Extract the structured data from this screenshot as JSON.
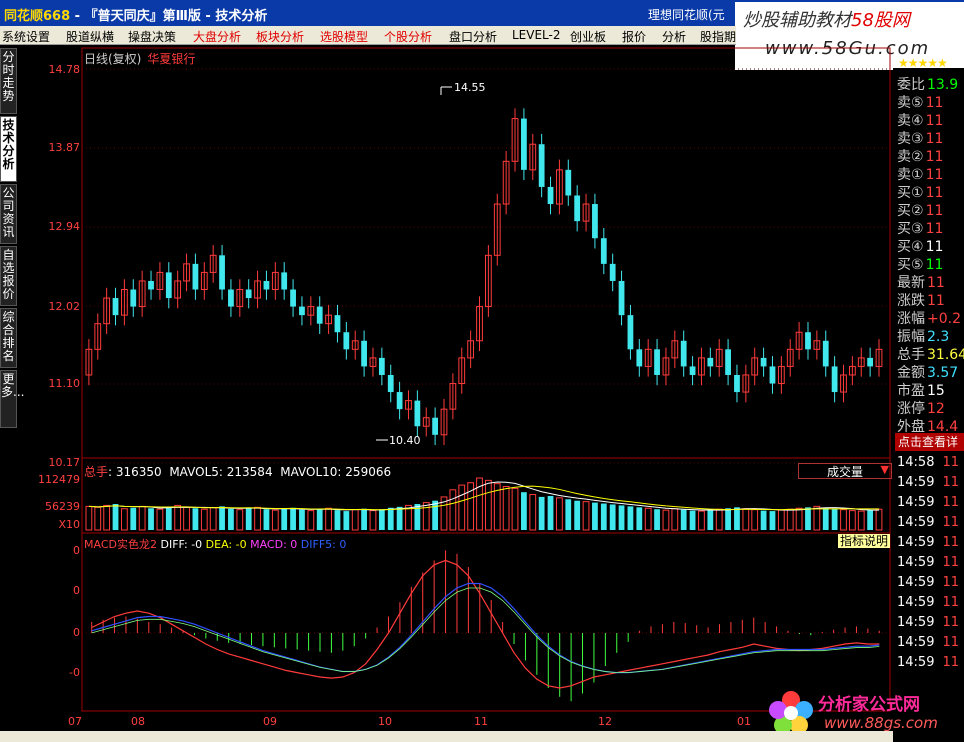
{
  "window": {
    "app": "同花顺668",
    "title_rest": " - 『普天同庆』第Ⅲ版 - 技术分析",
    "right_text": "理想同花顺(元"
  },
  "menu": [
    "系统设置",
    "股道纵横",
    "操盘决策",
    "大盘分析",
    "板块分析",
    "选股模型",
    "个股分析",
    "盘口分析",
    "LEVEL-2",
    "创业板",
    "报价",
    "分析",
    "股指期"
  ],
  "menu_red": [
    false,
    false,
    false,
    true,
    true,
    true,
    true,
    false,
    false,
    false,
    false,
    false,
    false
  ],
  "vtabs": [
    "分时走势",
    "技术分析",
    "公司资讯",
    "自选报价",
    "综合排名",
    "更多..."
  ],
  "chart": {
    "period": "日线(复权)",
    "stock": "华夏银行",
    "high_label": "14.55",
    "low_label": "10.40"
  },
  "price_axis": [
    "14.78",
    "13.87",
    "12.94",
    "12.02",
    "11.10",
    "10.17"
  ],
  "volume": {
    "label_total": "总手",
    "total": "316350",
    "mavol5_label": "MAVOL5:",
    "mavol5": "213584",
    "mavol10_label": "MAVOL10:",
    "mavol10": "259066",
    "dropdown": "成交量",
    "axis": [
      "112479",
      "56239",
      "X10"
    ]
  },
  "macd": {
    "title": "MACD实色龙2",
    "diff": "DIFF: -0",
    "dea": "DEA: -0",
    "macd": "MACD: 0",
    "other": "DIFF5: 0",
    "help": "指标说明",
    "axis": [
      "0",
      "0",
      "0",
      "-0"
    ]
  },
  "x_axis": [
    "07",
    "08",
    "09",
    "10",
    "11",
    "12",
    "01"
  ],
  "right_panel": {
    "rows": [
      {
        "label": "委比",
        "value": "13.9",
        "color": "#00ff00"
      },
      {
        "label": "卖⑤",
        "value": "11",
        "color": "#ff4040"
      },
      {
        "label": "卖④",
        "value": "11",
        "color": "#ff4040"
      },
      {
        "label": "卖③",
        "value": "11",
        "color": "#ff4040"
      },
      {
        "label": "卖②",
        "value": "11",
        "color": "#ff4040"
      },
      {
        "label": "卖①",
        "value": "11",
        "color": "#ff4040"
      },
      {
        "label": "买①",
        "value": "11",
        "color": "#ff4040"
      },
      {
        "label": "买②",
        "value": "11",
        "color": "#ff4040"
      },
      {
        "label": "买③",
        "value": "11",
        "color": "#ff4040"
      },
      {
        "label": "买④",
        "value": "11",
        "color": "#ffffff"
      },
      {
        "label": "买⑤",
        "value": "11",
        "color": "#00ff00"
      },
      {
        "label": "最新",
        "value": "11",
        "color": "#ff4040"
      },
      {
        "label": "涨跌",
        "value": "11",
        "color": "#ff4040"
      },
      {
        "label": "涨幅",
        "value": "+0.2",
        "color": "#ff4040"
      },
      {
        "label": "振幅",
        "value": "2.3",
        "color": "#40e0ff"
      },
      {
        "label": "总手",
        "value": "31.64",
        "color": "#ffff40"
      },
      {
        "label": "金额",
        "value": "3.57",
        "color": "#40e0ff"
      },
      {
        "label": "市盈",
        "value": "15",
        "color": "#ffffff"
      },
      {
        "label": "涨停",
        "value": "12",
        "color": "#ff4040"
      },
      {
        "label": "外盘",
        "value": "14.4",
        "color": "#ff4040"
      }
    ],
    "button": "点击查看详",
    "ticks": [
      "14:58",
      "14:59",
      "14:59",
      "14:59",
      "14:59",
      "14:59",
      "14:59",
      "14:59",
      "14:59",
      "14:59",
      "14:59"
    ],
    "tick_vals": [
      "11",
      "11",
      "11",
      "11",
      "11",
      "11",
      "11",
      "11",
      "11",
      "11",
      "11"
    ]
  },
  "watermark_top": {
    "text1": "炒股辅助教材",
    "text2": "58股网",
    "url": "www.58Gu.com"
  },
  "watermark_bottom": {
    "brand": "分析家公式网",
    "url": "www.88gs.com"
  },
  "colors": {
    "up": "#ff3b3b",
    "down": "#40e8ee",
    "diff": "#ffffff",
    "dea": "#ffff00",
    "macd_line": "#0000ff",
    "axis": "#ff2020"
  },
  "chart_data": {
    "type": "candlestick",
    "ylim": [
      10.17,
      14.78
    ],
    "candles": [
      [
        11.2,
        11.5
      ],
      [
        11.5,
        11.8
      ],
      [
        11.8,
        12.1
      ],
      [
        12.1,
        11.9
      ],
      [
        11.9,
        12.2
      ],
      [
        12.2,
        12.0
      ],
      [
        12.0,
        12.3
      ],
      [
        12.3,
        12.2
      ],
      [
        12.2,
        12.4
      ],
      [
        12.4,
        12.1
      ],
      [
        12.1,
        12.3
      ],
      [
        12.3,
        12.5
      ],
      [
        12.5,
        12.2
      ],
      [
        12.2,
        12.4
      ],
      [
        12.4,
        12.6
      ],
      [
        12.6,
        12.2
      ],
      [
        12.2,
        12.0
      ],
      [
        12.0,
        12.2
      ],
      [
        12.2,
        12.1
      ],
      [
        12.1,
        12.3
      ],
      [
        12.3,
        12.2
      ],
      [
        12.2,
        12.4
      ],
      [
        12.4,
        12.2
      ],
      [
        12.2,
        12.0
      ],
      [
        12.0,
        11.9
      ],
      [
        11.9,
        12.0
      ],
      [
        12.0,
        11.8
      ],
      [
        11.8,
        11.9
      ],
      [
        11.9,
        11.7
      ],
      [
        11.7,
        11.5
      ],
      [
        11.5,
        11.6
      ],
      [
        11.6,
        11.3
      ],
      [
        11.3,
        11.4
      ],
      [
        11.4,
        11.2
      ],
      [
        11.2,
        11.0
      ],
      [
        11.0,
        10.8
      ],
      [
        10.8,
        10.9
      ],
      [
        10.9,
        10.6
      ],
      [
        10.6,
        10.7
      ],
      [
        10.7,
        10.5
      ],
      [
        10.5,
        10.8
      ],
      [
        10.8,
        11.1
      ],
      [
        11.1,
        11.4
      ],
      [
        11.4,
        11.6
      ],
      [
        11.6,
        12.0
      ],
      [
        12.0,
        12.6
      ],
      [
        12.6,
        13.2
      ],
      [
        13.2,
        13.7
      ],
      [
        13.7,
        14.2
      ],
      [
        14.2,
        13.6
      ],
      [
        13.6,
        13.9
      ],
      [
        13.9,
        13.4
      ],
      [
        13.4,
        13.2
      ],
      [
        13.2,
        13.6
      ],
      [
        13.6,
        13.3
      ],
      [
        13.3,
        13.0
      ],
      [
        13.0,
        13.2
      ],
      [
        13.2,
        12.8
      ],
      [
        12.8,
        12.5
      ],
      [
        12.5,
        12.3
      ],
      [
        12.3,
        11.9
      ],
      [
        11.9,
        11.5
      ],
      [
        11.5,
        11.3
      ],
      [
        11.3,
        11.5
      ],
      [
        11.5,
        11.2
      ],
      [
        11.2,
        11.4
      ],
      [
        11.4,
        11.6
      ],
      [
        11.6,
        11.3
      ],
      [
        11.3,
        11.2
      ],
      [
        11.2,
        11.4
      ],
      [
        11.4,
        11.3
      ],
      [
        11.3,
        11.5
      ],
      [
        11.5,
        11.2
      ],
      [
        11.2,
        11.0
      ],
      [
        11.0,
        11.2
      ],
      [
        11.2,
        11.4
      ],
      [
        11.4,
        11.3
      ],
      [
        11.3,
        11.1
      ],
      [
        11.1,
        11.3
      ],
      [
        11.3,
        11.5
      ],
      [
        11.5,
        11.7
      ],
      [
        11.7,
        11.5
      ],
      [
        11.5,
        11.6
      ],
      [
        11.6,
        11.3
      ],
      [
        11.3,
        11.0
      ],
      [
        11.0,
        11.2
      ],
      [
        11.2,
        11.3
      ],
      [
        11.3,
        11.4
      ],
      [
        11.4,
        11.3
      ],
      [
        11.3,
        11.5
      ]
    ],
    "volumes": [
      50,
      48,
      52,
      55,
      45,
      47,
      50,
      46,
      44,
      49,
      52,
      48,
      46,
      44,
      47,
      50,
      45,
      43,
      46,
      48,
      44,
      42,
      45,
      47,
      43,
      41,
      44,
      46,
      42,
      40,
      43,
      45,
      41,
      44,
      47,
      49,
      52,
      55,
      58,
      62,
      70,
      85,
      95,
      100,
      110,
      105,
      98,
      92,
      88,
      80,
      75,
      70,
      72,
      68,
      65,
      62,
      60,
      58,
      56,
      54,
      52,
      50,
      48,
      46,
      44,
      42,
      45,
      43,
      41,
      40,
      42,
      44,
      46,
      48,
      45,
      43,
      41,
      40,
      42,
      44,
      46,
      48,
      50,
      47,
      45,
      43,
      41,
      40,
      42,
      44
    ],
    "macd_hist": [
      0.1,
      0.12,
      0.14,
      0.15,
      0.13,
      0.1,
      0.08,
      0.05,
      0.02,
      -0.02,
      -0.05,
      -0.07,
      -0.09,
      -0.1,
      -0.11,
      -0.12,
      -0.13,
      -0.14,
      -0.15,
      -0.16,
      -0.17,
      -0.18,
      -0.16,
      -0.12,
      -0.05,
      0.05,
      0.15,
      0.28,
      0.42,
      0.55,
      0.66,
      0.75,
      0.72,
      0.6,
      0.45,
      0.3,
      0.1,
      -0.1,
      -0.25,
      -0.38,
      -0.5,
      -0.58,
      -0.62,
      -0.55,
      -0.45,
      -0.3,
      -0.18,
      -0.08,
      0.02,
      0.06,
      0.08,
      0.1,
      0.09,
      0.07,
      0.05,
      0.08,
      0.1,
      0.12,
      0.14,
      0.1,
      0.06,
      0.02,
      -0.01,
      -0.02,
      0.01,
      0.03,
      0.05,
      0.06,
      0.04,
      0.02
    ],
    "diff": [
      0.05,
      0.1,
      0.15,
      0.18,
      0.2,
      0.18,
      0.14,
      0.08,
      0.02,
      -0.04,
      -0.1,
      -0.15,
      -0.19,
      -0.22,
      -0.25,
      -0.28,
      -0.31,
      -0.34,
      -0.36,
      -0.38,
      -0.4,
      -0.41,
      -0.4,
      -0.36,
      -0.28,
      -0.15,
      0.0,
      0.18,
      0.36,
      0.52,
      0.62,
      0.66,
      0.62,
      0.52,
      0.36,
      0.18,
      0.0,
      -0.18,
      -0.32,
      -0.42,
      -0.48,
      -0.5,
      -0.48,
      -0.44,
      -0.4,
      -0.38,
      -0.36,
      -0.34,
      -0.32,
      -0.3,
      -0.28,
      -0.26,
      -0.24,
      -0.22,
      -0.2,
      -0.17,
      -0.15,
      -0.13,
      -0.1,
      -0.12,
      -0.14,
      -0.15,
      -0.16,
      -0.15,
      -0.14,
      -0.12,
      -0.1,
      -0.09,
      -0.1,
      -0.1
    ],
    "dea": [
      0.02,
      0.05,
      0.08,
      0.11,
      0.14,
      0.15,
      0.15,
      0.13,
      0.11,
      0.08,
      0.04,
      0.0,
      -0.04,
      -0.08,
      -0.12,
      -0.16,
      -0.19,
      -0.22,
      -0.25,
      -0.28,
      -0.31,
      -0.33,
      -0.35,
      -0.35,
      -0.33,
      -0.29,
      -0.22,
      -0.13,
      -0.02,
      0.1,
      0.22,
      0.33,
      0.41,
      0.45,
      0.45,
      0.41,
      0.33,
      0.22,
      0.1,
      -0.02,
      -0.12,
      -0.2,
      -0.26,
      -0.3,
      -0.33,
      -0.35,
      -0.36,
      -0.36,
      -0.35,
      -0.34,
      -0.33,
      -0.31,
      -0.29,
      -0.27,
      -0.25,
      -0.23,
      -0.21,
      -0.19,
      -0.17,
      -0.16,
      -0.15,
      -0.15,
      -0.15,
      -0.15,
      -0.15,
      -0.14,
      -0.13,
      -0.12,
      -0.12,
      -0.11
    ]
  }
}
